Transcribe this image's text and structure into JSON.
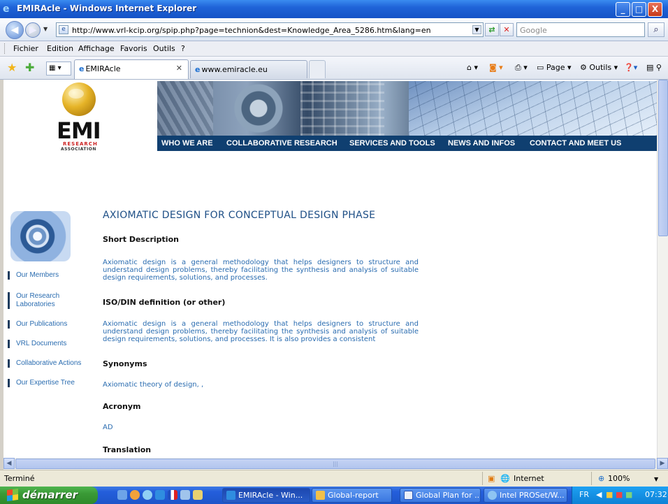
{
  "window": {
    "title": "EMIRAcle - Windows Internet Explorer",
    "min": "_",
    "max": "□",
    "close": "X"
  },
  "address": {
    "url": "http://www.vrl-kcip.org/spip.php?page=technion&dest=Knowledge_Area_5286.htm&lang=en",
    "search_placeholder": "Google"
  },
  "menu": [
    "Fichier",
    "Edition",
    "Affichage",
    "Favoris",
    "Outils",
    "?"
  ],
  "tabs": [
    {
      "label": "EMIRAcle",
      "active": true
    },
    {
      "label": "www.emiracle.eu",
      "active": false
    }
  ],
  "commands": {
    "page": "Page",
    "tools": "Outils"
  },
  "site": {
    "logo_text": "EMI",
    "logo_research": "RESEARCH",
    "logo_association": "ASSOCIATION",
    "nav": [
      "WHO WE ARE",
      "COLLABORATIVE RESEARCH",
      "SERVICES AND TOOLS",
      "NEWS AND INFOS",
      "CONTACT AND MEET US"
    ],
    "left_links": [
      "Our Members",
      "Our Research Laboratories",
      "Our Publications",
      "VRL Documents",
      "Collaborative Actions",
      "Our Expertise Tree"
    ]
  },
  "article": {
    "title": "AXIOMATIC DESIGN FOR CONCEPTUAL DESIGN PHASE",
    "short_description_heading": "Short Description",
    "short_description": "Axiomatic design is a general methodology that helps designers to structure and understand design problems, thereby facilitating the synthesis and analysis of suitable design requirements, solutions, and processes.",
    "iso_heading": "ISO/DIN definition (or other)",
    "iso_text": "Axiomatic design is a general methodology that helps designers to structure and understand design problems, thereby facilitating the synthesis and analysis of suitable design requirements, solutions, and processes. It is  also provides a consistent",
    "synonyms_heading": "Synonyms",
    "synonyms_text": "Axiomatic theory of design,  ,",
    "acronym_heading": "Acronym",
    "acronym_text": "AD",
    "translation_heading": "Translation"
  },
  "status": {
    "left": "Terminé",
    "zone": "Internet",
    "zoom": "100%"
  },
  "taskbar": {
    "start": "démarrer",
    "tasks": [
      "EMIRAcle - Win...",
      "Global-report",
      "Global Plan for ...",
      "Intel PROSet/W..."
    ],
    "lang": "FR",
    "clock": "07:32"
  },
  "colors": {
    "link": "#2a6cb0",
    "title": "#1e4f86",
    "navstrip": "#0f3f70"
  }
}
